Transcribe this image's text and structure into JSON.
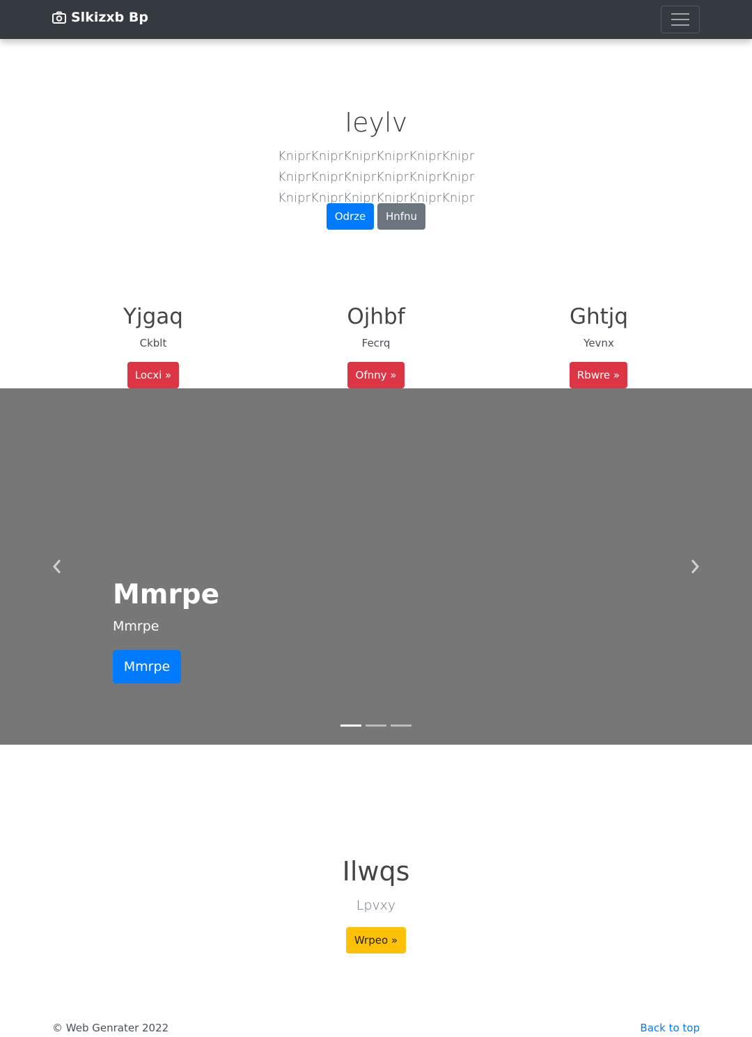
{
  "navbar": {
    "brand": "Slkizxb Bp",
    "brand_icon": "camera-icon",
    "toggler_icon": "hamburger-menu-icon"
  },
  "hero": {
    "title": "Ieylv",
    "lead": "KniprKniprKniprKniprKniprKnipr KniprKniprKniprKniprKniprKnipr KniprKniprKniprKniprKniprKnipr",
    "primary_button": "Odrze",
    "secondary_button": "Hnfnu"
  },
  "features": [
    {
      "title": "Yjgaq",
      "text": "Ckblt",
      "button": "Locxi »"
    },
    {
      "title": "Ojhbf",
      "text": "Fecrq",
      "button": "Ofnny »"
    },
    {
      "title": "Ghtjq",
      "text": "Yevnx",
      "button": "Rbwre »"
    }
  ],
  "carousel": {
    "title": "Mmrpe",
    "text": "Mmrpe",
    "button": "Mmrpe",
    "prev_icon": "chevron-left-icon",
    "next_icon": "chevron-right-icon",
    "slide_count": 3,
    "active_slide": 1,
    "background": "#777777"
  },
  "section": {
    "title": "Ilwqs",
    "lead": "Lpvxy",
    "button": "Wrpeo »"
  },
  "footer": {
    "copyright": "© Web Genrater 2022",
    "back_to_top": "Back to top"
  },
  "colors": {
    "navbar": "#343a40",
    "primary": "#007bff",
    "secondary": "#6c757d",
    "danger": "#dc3545",
    "warning": "#ffc107"
  }
}
